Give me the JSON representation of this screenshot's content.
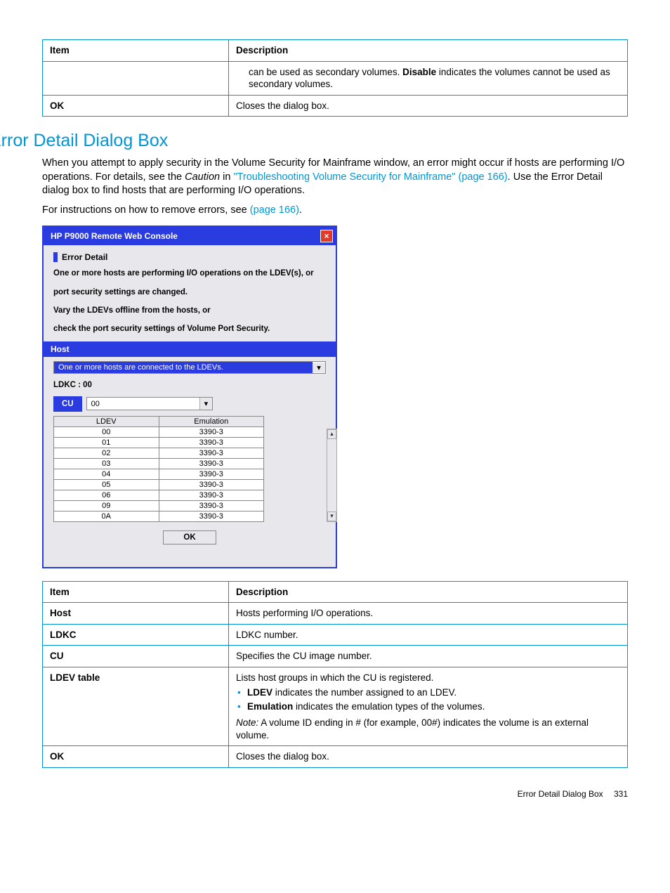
{
  "topTable": {
    "head": {
      "item": "Item",
      "desc": "Description"
    },
    "rows": [
      {
        "item": "",
        "desc_pre": "can be used as secondary volumes. ",
        "desc_bold": "Disable",
        "desc_post": " indicates the volumes cannot be used as secondary volumes."
      },
      {
        "item": "OK",
        "desc": "Closes the dialog box."
      }
    ]
  },
  "heading": "Error Detail Dialog Box",
  "para1_a": "When you attempt to apply security in the Volume Security for Mainframe window, an error might occur if hosts are performing I/O operations. For details, see the ",
  "para1_caution": "Caution",
  "para1_b": " in ",
  "para1_link": "\"Troubleshooting Volume Security for Mainframe\" (page 166)",
  "para1_c": ". Use the Error Detail dialog box to find hosts that are performing I/O operations.",
  "para2_a": "For instructions on how to remove errors, see ",
  "para2_link": "(page 166)",
  "para2_b": ".",
  "dialog": {
    "title": "HP P9000 Remote Web Console",
    "subtitle": "Error Detail",
    "msg1": "One or more hosts are performing I/O operations on the LDEV(s), or",
    "msg2": "port security settings are changed.",
    "msg3": "Vary the LDEVs offline from the hosts, or",
    "msg4": "check the port security settings of Volume Port Security.",
    "hostHead": "Host",
    "hostSel": "One or more hosts are connected to the LDEVs.",
    "ldkc": "LDKC : 00",
    "cuLabel": "CU",
    "cuVal": "00",
    "cols": {
      "ldev": "LDEV",
      "emu": "Emulation"
    },
    "rows": [
      {
        "l": "00",
        "e": "3390-3"
      },
      {
        "l": "01",
        "e": "3390-3"
      },
      {
        "l": "02",
        "e": "3390-3"
      },
      {
        "l": "03",
        "e": "3390-3"
      },
      {
        "l": "04",
        "e": "3390-3"
      },
      {
        "l": "05",
        "e": "3390-3"
      },
      {
        "l": "06",
        "e": "3390-3"
      },
      {
        "l": "09",
        "e": "3390-3"
      },
      {
        "l": "0A",
        "e": "3390-3"
      }
    ],
    "ok": "OK"
  },
  "bottomTable": {
    "head": {
      "item": "Item",
      "desc": "Description"
    },
    "rows": {
      "host": {
        "item": "Host",
        "desc": "Hosts performing I/O operations."
      },
      "ldkc": {
        "item": "LDKC",
        "desc": "LDKC number."
      },
      "cu": {
        "item": "CU",
        "desc": "Specifies the CU image number."
      },
      "ldev": {
        "item": "LDEV table",
        "lead": "Lists host groups in which the CU is registered.",
        "b1_b": "LDEV",
        "b1_r": " indicates the number assigned to an LDEV.",
        "b2_b": "Emulation",
        "b2_r": " indicates the emulation types of the volumes.",
        "note_i": "Note:",
        "note_r": " A volume ID ending in # (for example, 00#) indicates the volume is an external volume."
      },
      "ok": {
        "item": "OK",
        "desc": "Closes the dialog box."
      }
    }
  },
  "footer": {
    "title": "Error Detail Dialog Box",
    "page": "331"
  }
}
